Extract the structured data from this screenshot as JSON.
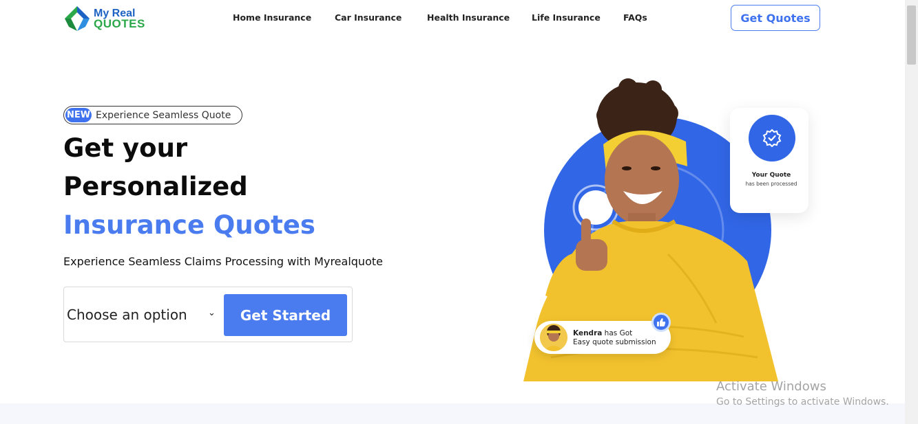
{
  "header": {
    "logo": {
      "line1": "My Real",
      "line2": "QUOTES"
    },
    "nav": [
      {
        "label": "Home Insurance"
      },
      {
        "label": "Car Insurance"
      },
      {
        "label": "Health Insurance"
      },
      {
        "label": "Life Insurance"
      },
      {
        "label": "FAQs"
      }
    ],
    "cta_label": "Get Quotes"
  },
  "hero": {
    "badge_pill": "NEW",
    "badge_text": "Experience Seamless Quote",
    "headline": [
      "Get your",
      "Personalized",
      "Insurance Quotes"
    ],
    "subtitle": "Experience Seamless Claims Processing with Myrealquote",
    "select_value": "Choose an option",
    "start_label": "Get Started"
  },
  "quote_card": {
    "title": "Your Quote",
    "subtitle": "has been processed"
  },
  "chip": {
    "name": "Kendra",
    "name_suffix": " has Got",
    "text": "Easy quote submission"
  },
  "windows_notice": {
    "title": "Activate Windows",
    "subtitle": "Go to Settings to activate Windows."
  },
  "colors": {
    "brand_blue": "#4a7cf0",
    "hero_circle": "#3166e6",
    "sweater": "#f2c22e",
    "logo_green": "#2ba84a"
  },
  "icons": [
    "logo-icon",
    "chevron-down-icon",
    "verified-check-icon",
    "thumbs-up-icon"
  ]
}
